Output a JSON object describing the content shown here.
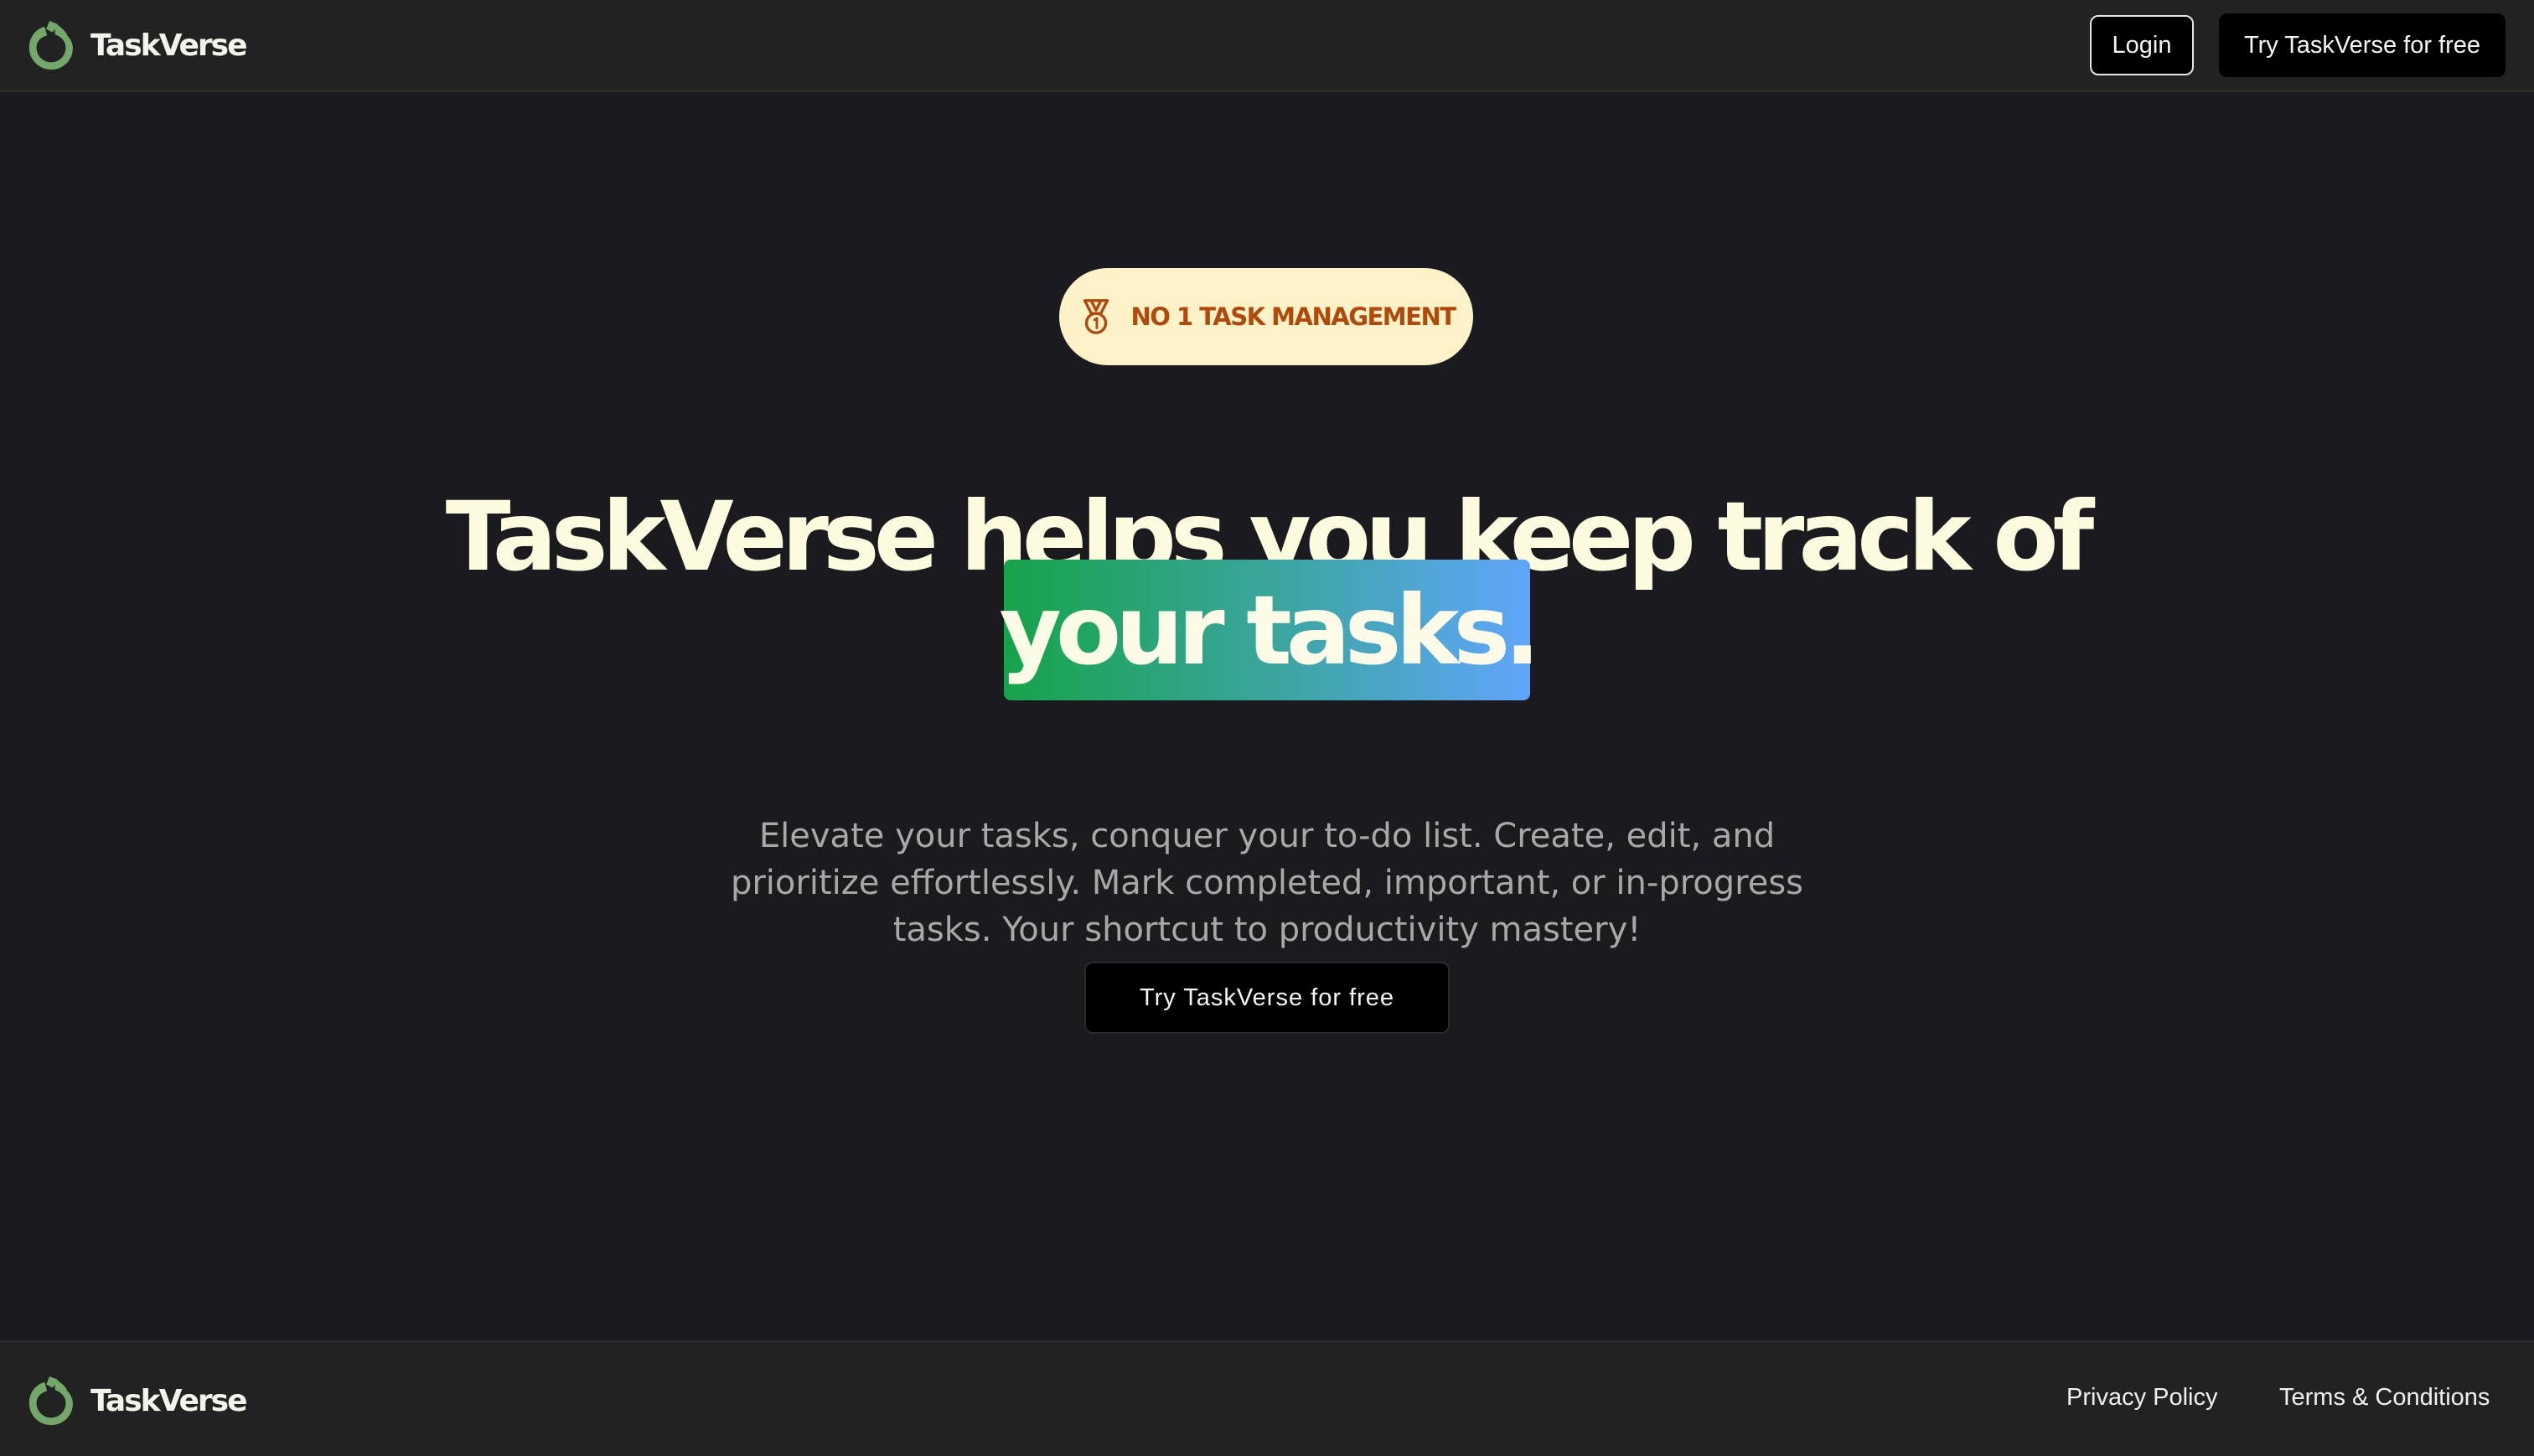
{
  "header": {
    "brand_name": "TaskVerse",
    "logo_icon": "taskverse-ring-logo-icon",
    "login_label": "Login",
    "cta_label": "Try TaskVerse for free"
  },
  "hero": {
    "badge_icon": "medal-icon",
    "badge_label": "NO 1 TASK MANAGEMENT",
    "headline": "TaskVerse helps you keep track of",
    "highlight": "your tasks.",
    "description": "Elevate your tasks, conquer your to-do list. Create, edit, and prioritize effortlessly. Mark completed, important, or in-progress tasks. Your shortcut to productivity mastery!",
    "cta_label": "Try TaskVerse for free"
  },
  "footer": {
    "brand_name": "TaskVerse",
    "privacy_label": "Privacy Policy",
    "terms_label": "Terms & Conditions"
  },
  "colors": {
    "page_background": "#1b1b1f",
    "bar_background": "#222222",
    "logo_green": "#74a86a",
    "headline": "#fcfbe0",
    "badge_background": "#fcf1c7",
    "badge_text": "#b04a0c",
    "gradient_start": "#16a34a",
    "gradient_end": "#60a5fa"
  }
}
